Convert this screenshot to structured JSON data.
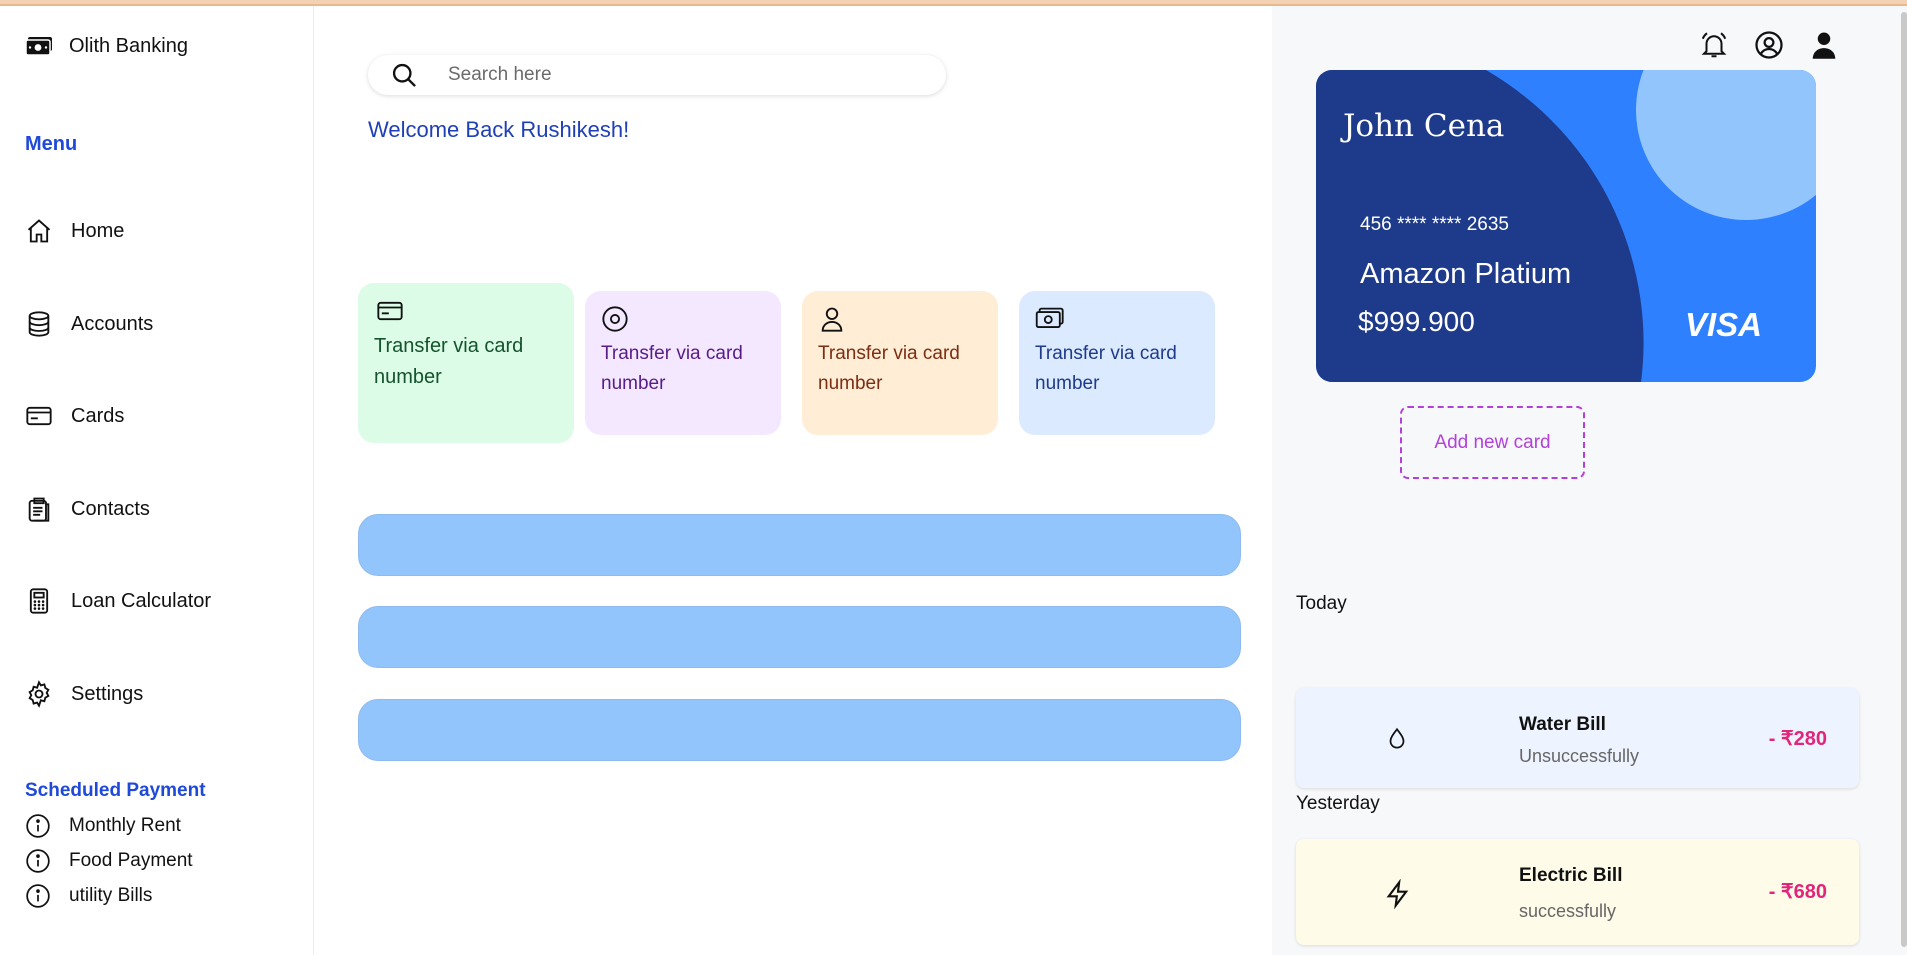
{
  "app": {
    "brand": "Olith Banking"
  },
  "sidebar": {
    "menu_title": "Menu",
    "items": [
      {
        "label": "Home",
        "icon": "home-icon"
      },
      {
        "label": "Accounts",
        "icon": "database-icon"
      },
      {
        "label": "Cards",
        "icon": "credit-card-icon"
      },
      {
        "label": "Contacts",
        "icon": "clipboard-icon"
      },
      {
        "label": "Loan Calculator",
        "icon": "calculator-icon"
      },
      {
        "label": "Settings",
        "icon": "gear-icon"
      }
    ],
    "scheduled_title": "Scheduled Payment",
    "scheduled": [
      {
        "label": "Monthly Rent",
        "icon": "info-icon"
      },
      {
        "label": "Food Payment",
        "icon": "info-icon"
      },
      {
        "label": "utility Bills",
        "icon": "info-icon"
      }
    ]
  },
  "main": {
    "search_placeholder": "Search here",
    "welcome": "Welcome Back Rushikesh!",
    "transfer_cards": [
      {
        "label": "Transfer via card number",
        "icon": "credit-card-icon",
        "bg": "#dcfce7",
        "color": "#14532d"
      },
      {
        "label": "Transfer via card number",
        "icon": "circle-stop-icon",
        "bg": "#f3e8ff",
        "color": "#581c87"
      },
      {
        "label": "Transfer via card number",
        "icon": "user-icon",
        "bg": "#ffedd5",
        "color": "#7c2d12"
      },
      {
        "label": "Transfer via card number",
        "icon": "cash-icon",
        "bg": "#dbeafe",
        "color": "#1e3a8a"
      }
    ]
  },
  "right": {
    "card": {
      "holder": "John Cena",
      "number": "456 **** **** 2635",
      "name": "Amazon Platium",
      "amount": "$999.900",
      "network": "VISA"
    },
    "add_card": "Add new card",
    "today": "Today",
    "yesterday": "Yesterday",
    "transactions": [
      {
        "title": "Water Bill",
        "status": "Unsuccessfully",
        "amount": "- ₹280",
        "icon": "droplet-icon"
      },
      {
        "title": "Electric Bill",
        "status": "successfully",
        "amount": "- ₹680",
        "icon": "lightning-icon"
      }
    ]
  },
  "colors": {
    "accent": "#1f49d9",
    "card_dark": "#1e3a8a",
    "card_light": "#2f80ff",
    "bar": "#93c5fd",
    "negative": "#e0257a",
    "add_card": "#b341d9"
  }
}
